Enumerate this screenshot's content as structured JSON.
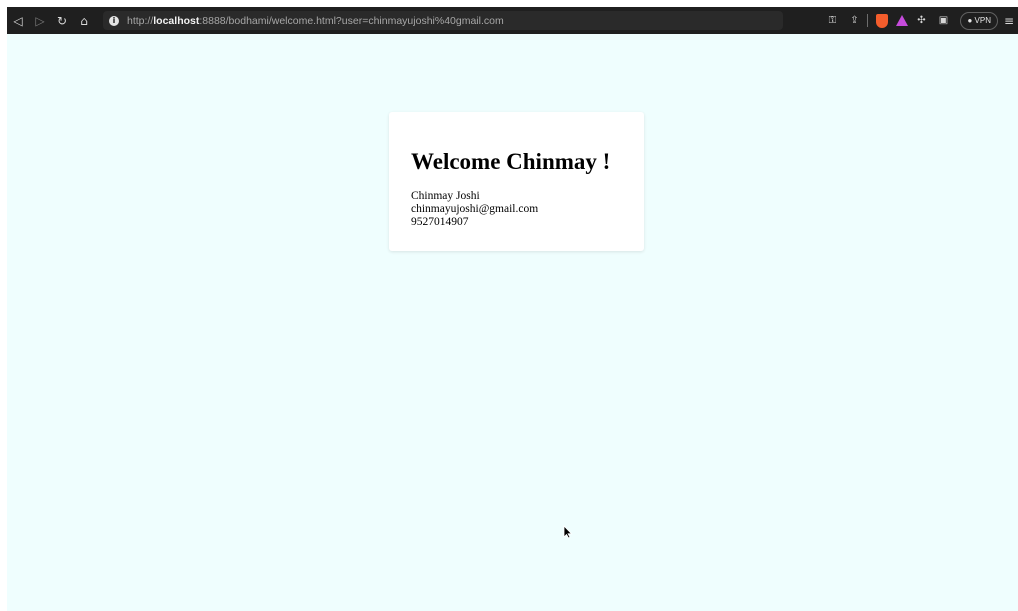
{
  "browser": {
    "url_prefix": "http://",
    "url_host": "localhost",
    "url_rest": ":8888/bodhami/welcome.html?user=chinmayujoshi%40gmail.com",
    "vpn_label": "VPN",
    "icons": {
      "back": "back-icon",
      "forward": "forward-icon",
      "reload": "reload-icon",
      "home": "home-icon",
      "info": "info-icon",
      "key": "key-icon",
      "share": "share-icon",
      "brave": "brave-icon",
      "rewards": "rewards-icon",
      "extensions": "extensions-icon",
      "wallet": "wallet-icon",
      "menu": "menu-icon"
    }
  },
  "card": {
    "title": "Welcome Chinmay !",
    "name": "Chinmay Joshi",
    "email": "chinmayujoshi@gmail.com",
    "phone": "9527014907"
  },
  "colors": {
    "page_background": "#effefe",
    "toolbar_background": "#1f1f1f",
    "brave_orange": "#f45d2c",
    "reward_purple": "#c64bdc"
  }
}
